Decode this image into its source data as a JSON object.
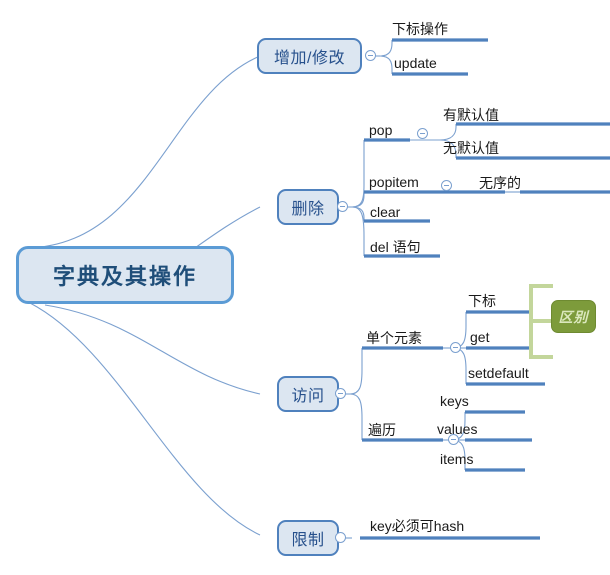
{
  "diagram": {
    "title": "字典及其操作",
    "type": "mind-map",
    "colors": {
      "node_fill": "#dce6f1",
      "node_border": "#4f81bd",
      "root_border": "#5b9bd5",
      "root_text": "#1f4e79",
      "branch_line": "#4f81bd",
      "thin_line": "#7ba0cf",
      "callout_fill": "#7d9b3b",
      "callout_text": "#dbe8bd",
      "bracket": "#c3d69b"
    },
    "root": {
      "label": "字典及其操作"
    },
    "branches": [
      {
        "id": "add-modify",
        "label": "增加/修改",
        "toggle": "minus",
        "children": [
          {
            "id": "subscript-op",
            "label": "下标操作"
          },
          {
            "id": "update",
            "label": "update"
          }
        ]
      },
      {
        "id": "delete",
        "label": "删除",
        "toggle": "minus",
        "children": [
          {
            "id": "pop",
            "label": "pop",
            "toggle": "minus",
            "children": [
              {
                "id": "with-default",
                "label": "有默认值"
              },
              {
                "id": "without-default",
                "label": "无默认值"
              }
            ]
          },
          {
            "id": "popitem",
            "label": "popitem",
            "toggle": "minus",
            "children": [
              {
                "id": "unordered",
                "label": "无序的"
              }
            ]
          },
          {
            "id": "clear",
            "label": "clear"
          },
          {
            "id": "del-statement",
            "label": "del 语句"
          }
        ]
      },
      {
        "id": "access",
        "label": "访问",
        "toggle": "minus",
        "children": [
          {
            "id": "single-element",
            "label": "单个元素",
            "toggle": "minus",
            "children": [
              {
                "id": "subscript",
                "label": "下标"
              },
              {
                "id": "get",
                "label": "get"
              },
              {
                "id": "setdefault",
                "label": "setdefault"
              }
            ]
          },
          {
            "id": "traverse",
            "label": "遍历",
            "toggle": "minus",
            "children": [
              {
                "id": "keys",
                "label": "keys"
              },
              {
                "id": "values",
                "label": "values"
              },
              {
                "id": "items",
                "label": "items"
              }
            ]
          }
        ]
      },
      {
        "id": "restriction",
        "label": "限制",
        "toggle": "empty",
        "children": [
          {
            "id": "key-hashable",
            "label": "key必须可hash"
          }
        ]
      }
    ],
    "callout": {
      "id": "difference",
      "label": "区别",
      "covers": [
        "下标",
        "get",
        "setdefault"
      ]
    }
  }
}
